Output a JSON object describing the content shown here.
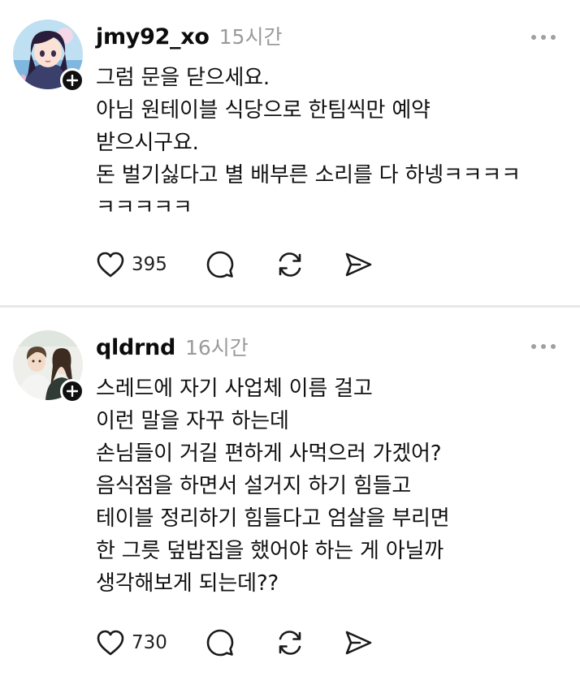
{
  "posts": [
    {
      "username": "jmy92_xo",
      "time": "15시간",
      "lines": [
        "그럼 문을 닫으세요.",
        "아님 원테이블 식당으로 한팀씩만 예약",
        "받으시구요.",
        "돈 벌기싫다고 별 배부른 소리를 다 하넹ㅋㅋㅋㅋ",
        "ㅋㅋㅋㅋㅋ"
      ],
      "likes": "395",
      "avatar_icon": "anime-girl-avatar"
    },
    {
      "username": "qldrnd",
      "time": "16시간",
      "lines": [
        "스레드에 자기 사업체 이름 걸고",
        "이런 말을 자꾸 하는데",
        "손님들이 거길 편하게 사먹으러 가겠어?",
        "음식점을 하면서 설거지 하기 힘들고",
        "테이블 정리하기 힘들다고 엄살을 부리면",
        "한 그릇 덮밥집을 했어야 하는 게 아닐까",
        "생각해보게 되는데??"
      ],
      "likes": "730",
      "avatar_icon": "couple-illustration-avatar"
    }
  ],
  "icons": {
    "like": "heart-icon",
    "comment": "comment-icon",
    "repost": "repost-icon",
    "share": "send-icon",
    "more": "more-dots-icon",
    "follow": "plus-icon"
  },
  "colors": {
    "text": "#101010",
    "muted": "#9a9a9a",
    "divider": "#e8e8e8",
    "badge": "#101010"
  }
}
